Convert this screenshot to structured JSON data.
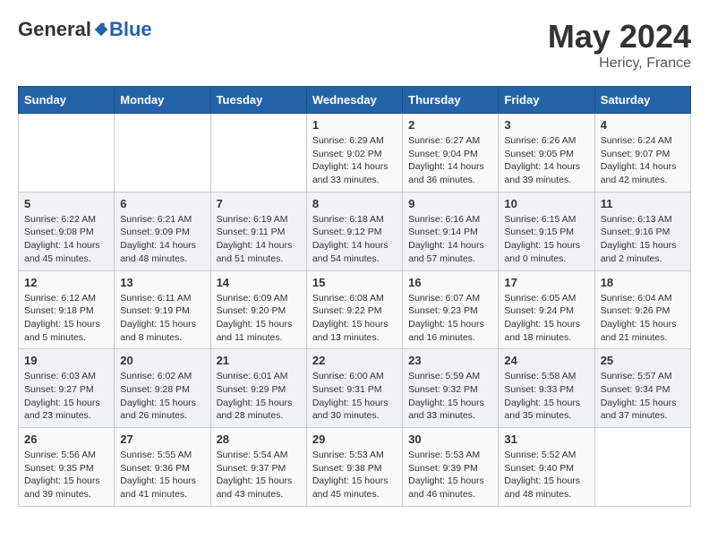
{
  "header": {
    "logo_general": "General",
    "logo_blue": "Blue",
    "month_year": "May 2024",
    "location": "Hericy, France"
  },
  "days_of_week": [
    "Sunday",
    "Monday",
    "Tuesday",
    "Wednesday",
    "Thursday",
    "Friday",
    "Saturday"
  ],
  "weeks": [
    [
      {
        "day": "",
        "info": ""
      },
      {
        "day": "",
        "info": ""
      },
      {
        "day": "",
        "info": ""
      },
      {
        "day": "1",
        "info": "Sunrise: 6:29 AM\nSunset: 9:02 PM\nDaylight: 14 hours and 33 minutes."
      },
      {
        "day": "2",
        "info": "Sunrise: 6:27 AM\nSunset: 9:04 PM\nDaylight: 14 hours and 36 minutes."
      },
      {
        "day": "3",
        "info": "Sunrise: 6:26 AM\nSunset: 9:05 PM\nDaylight: 14 hours and 39 minutes."
      },
      {
        "day": "4",
        "info": "Sunrise: 6:24 AM\nSunset: 9:07 PM\nDaylight: 14 hours and 42 minutes."
      }
    ],
    [
      {
        "day": "5",
        "info": "Sunrise: 6:22 AM\nSunset: 9:08 PM\nDaylight: 14 hours and 45 minutes."
      },
      {
        "day": "6",
        "info": "Sunrise: 6:21 AM\nSunset: 9:09 PM\nDaylight: 14 hours and 48 minutes."
      },
      {
        "day": "7",
        "info": "Sunrise: 6:19 AM\nSunset: 9:11 PM\nDaylight: 14 hours and 51 minutes."
      },
      {
        "day": "8",
        "info": "Sunrise: 6:18 AM\nSunset: 9:12 PM\nDaylight: 14 hours and 54 minutes."
      },
      {
        "day": "9",
        "info": "Sunrise: 6:16 AM\nSunset: 9:14 PM\nDaylight: 14 hours and 57 minutes."
      },
      {
        "day": "10",
        "info": "Sunrise: 6:15 AM\nSunset: 9:15 PM\nDaylight: 15 hours and 0 minutes."
      },
      {
        "day": "11",
        "info": "Sunrise: 6:13 AM\nSunset: 9:16 PM\nDaylight: 15 hours and 2 minutes."
      }
    ],
    [
      {
        "day": "12",
        "info": "Sunrise: 6:12 AM\nSunset: 9:18 PM\nDaylight: 15 hours and 5 minutes."
      },
      {
        "day": "13",
        "info": "Sunrise: 6:11 AM\nSunset: 9:19 PM\nDaylight: 15 hours and 8 minutes."
      },
      {
        "day": "14",
        "info": "Sunrise: 6:09 AM\nSunset: 9:20 PM\nDaylight: 15 hours and 11 minutes."
      },
      {
        "day": "15",
        "info": "Sunrise: 6:08 AM\nSunset: 9:22 PM\nDaylight: 15 hours and 13 minutes."
      },
      {
        "day": "16",
        "info": "Sunrise: 6:07 AM\nSunset: 9:23 PM\nDaylight: 15 hours and 16 minutes."
      },
      {
        "day": "17",
        "info": "Sunrise: 6:05 AM\nSunset: 9:24 PM\nDaylight: 15 hours and 18 minutes."
      },
      {
        "day": "18",
        "info": "Sunrise: 6:04 AM\nSunset: 9:26 PM\nDaylight: 15 hours and 21 minutes."
      }
    ],
    [
      {
        "day": "19",
        "info": "Sunrise: 6:03 AM\nSunset: 9:27 PM\nDaylight: 15 hours and 23 minutes."
      },
      {
        "day": "20",
        "info": "Sunrise: 6:02 AM\nSunset: 9:28 PM\nDaylight: 15 hours and 26 minutes."
      },
      {
        "day": "21",
        "info": "Sunrise: 6:01 AM\nSunset: 9:29 PM\nDaylight: 15 hours and 28 minutes."
      },
      {
        "day": "22",
        "info": "Sunrise: 6:00 AM\nSunset: 9:31 PM\nDaylight: 15 hours and 30 minutes."
      },
      {
        "day": "23",
        "info": "Sunrise: 5:59 AM\nSunset: 9:32 PM\nDaylight: 15 hours and 33 minutes."
      },
      {
        "day": "24",
        "info": "Sunrise: 5:58 AM\nSunset: 9:33 PM\nDaylight: 15 hours and 35 minutes."
      },
      {
        "day": "25",
        "info": "Sunrise: 5:57 AM\nSunset: 9:34 PM\nDaylight: 15 hours and 37 minutes."
      }
    ],
    [
      {
        "day": "26",
        "info": "Sunrise: 5:56 AM\nSunset: 9:35 PM\nDaylight: 15 hours and 39 minutes."
      },
      {
        "day": "27",
        "info": "Sunrise: 5:55 AM\nSunset: 9:36 PM\nDaylight: 15 hours and 41 minutes."
      },
      {
        "day": "28",
        "info": "Sunrise: 5:54 AM\nSunset: 9:37 PM\nDaylight: 15 hours and 43 minutes."
      },
      {
        "day": "29",
        "info": "Sunrise: 5:53 AM\nSunset: 9:38 PM\nDaylight: 15 hours and 45 minutes."
      },
      {
        "day": "30",
        "info": "Sunrise: 5:53 AM\nSunset: 9:39 PM\nDaylight: 15 hours and 46 minutes."
      },
      {
        "day": "31",
        "info": "Sunrise: 5:52 AM\nSunset: 9:40 PM\nDaylight: 15 hours and 48 minutes."
      },
      {
        "day": "",
        "info": ""
      }
    ]
  ]
}
